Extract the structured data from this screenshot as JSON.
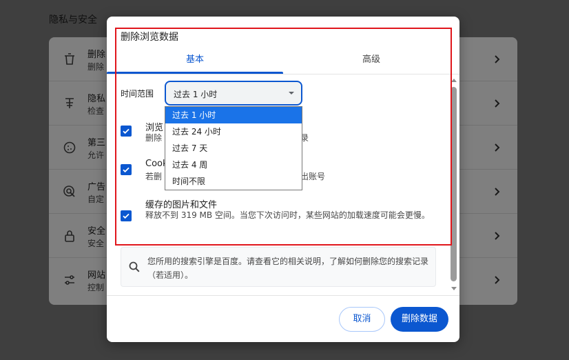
{
  "background": {
    "section_title": "隐私与安全",
    "rows": [
      {
        "icon": "trash-icon",
        "title": "删除",
        "subtitle": "删除"
      },
      {
        "icon": "shield-check-icon",
        "title": "隐私",
        "subtitle": "检查"
      },
      {
        "icon": "cookie-icon",
        "title": "第三",
        "subtitle": "允许"
      },
      {
        "icon": "ad-target-icon",
        "title": "广告",
        "subtitle": "自定"
      },
      {
        "icon": "lock-icon",
        "title": "安全",
        "subtitle": "安全"
      },
      {
        "icon": "tune-icon",
        "title": "网站",
        "subtitle": "控制"
      }
    ]
  },
  "dialog": {
    "title": "删除浏览数据",
    "tabs": [
      {
        "label": "基本",
        "active": true
      },
      {
        "label": "高级",
        "active": false
      }
    ],
    "time_range": {
      "label": "时间范围",
      "selected": "过去 1 小时",
      "options": [
        "过去 1 小时",
        "过去 24 小时",
        "过去 7 天",
        "过去 4 周",
        "时间不限"
      ]
    },
    "items": [
      {
        "title": "浏览",
        "desc": "删除",
        "desc_tail": "录",
        "checked": true
      },
      {
        "title": "Cook",
        "desc": "若删",
        "desc_tail": "出账号",
        "checked": true
      },
      {
        "title": "缓存的图片和文件",
        "desc": "释放不到 319 MB 空间。当您下次访问时，某些网站的加载速度可能会更慢。",
        "checked": true
      }
    ],
    "search_note": "您所用的搜索引擎是百度。请查看它的相关说明，了解如何删除您的搜索记录（若适用）。",
    "cancel_label": "取消",
    "delete_label": "删除数据"
  },
  "colors": {
    "accent": "#0b57d0",
    "highlight_box": "#e0151b",
    "dropdown_selected": "#1a73e8"
  }
}
